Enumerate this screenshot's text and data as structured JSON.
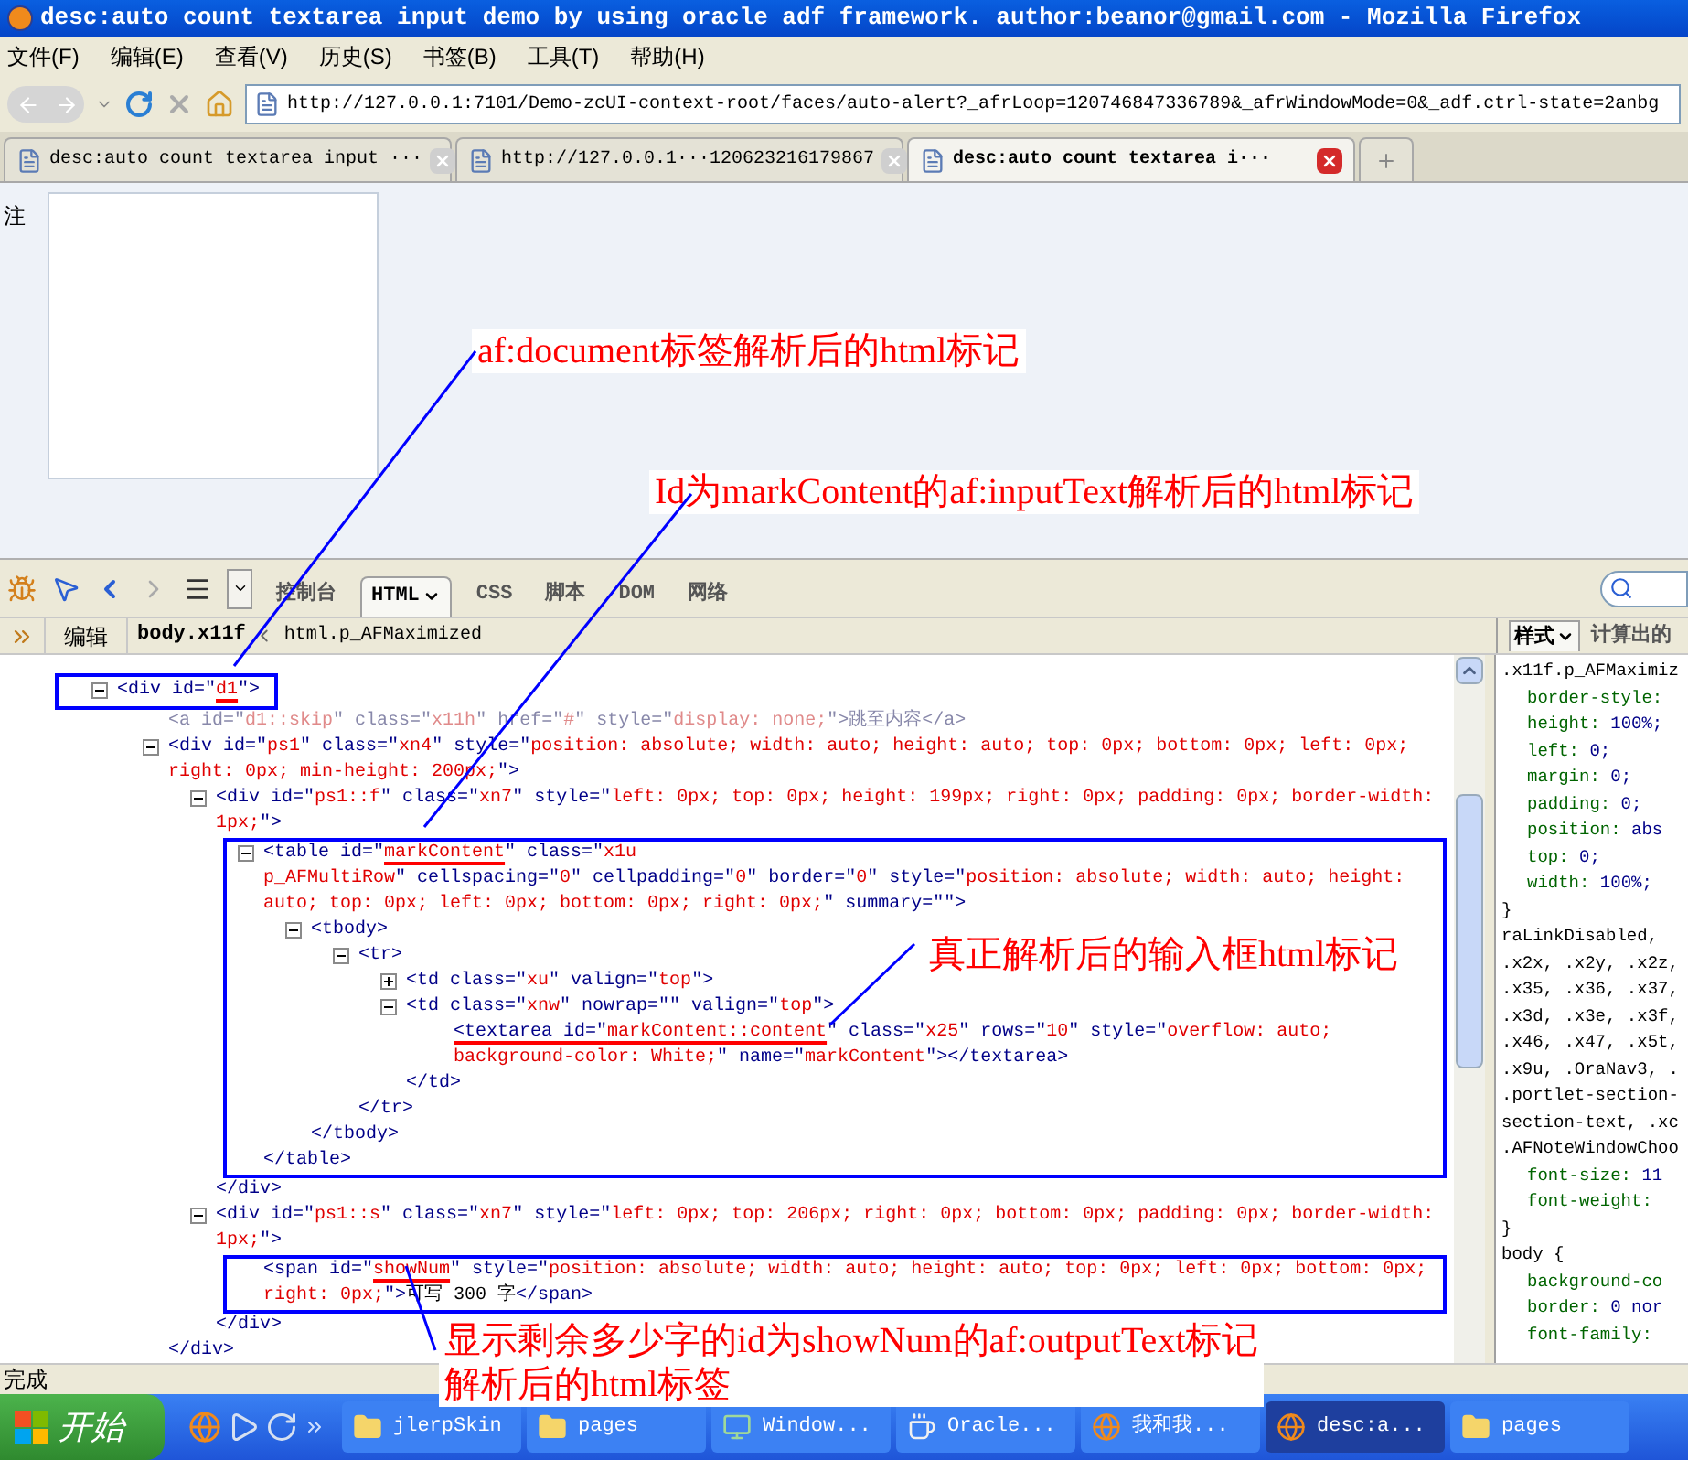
{
  "window": {
    "title": "desc:auto count textarea input demo by using oracle adf framework. author:beanor@gmail.com - Mozilla Firefox"
  },
  "menu": [
    "文件(F)",
    "编辑(E)",
    "查看(V)",
    "历史(S)",
    "书签(B)",
    "工具(T)",
    "帮助(H)"
  ],
  "address": "http://127.0.0.1:7101/Demo-zcUI-context-root/faces/auto-alert?_afrLoop=120746847336789&_afrWindowMode=0&_adf.ctrl-state=2anbg",
  "tabs": [
    {
      "label": "desc:auto count textarea input ···",
      "selected": false
    },
    {
      "label": "http://127.0.0.1···120623216179867",
      "selected": false
    },
    {
      "label": "desc:auto count textarea i···",
      "selected": true
    }
  ],
  "page": {
    "field_label": "注"
  },
  "annotations": [
    {
      "lines": [
        "af:document标签解析后的html标记"
      ]
    },
    {
      "lines": [
        "Id为markContent的af:inputText解析后的html标记"
      ]
    },
    {
      "lines": [
        "真正解析后的输入框html标记"
      ]
    },
    {
      "lines": [
        "显示剩余多少字的id为showNum的af:outputText标记",
        "解析后的html标签"
      ]
    }
  ],
  "firebug": {
    "tabs": [
      {
        "label": "控制台",
        "selected": false,
        "menu": false
      },
      {
        "label": "HTML",
        "selected": true,
        "menu": true
      },
      {
        "label": "CSS",
        "selected": false,
        "menu": false
      },
      {
        "label": "脚本",
        "selected": false,
        "menu": false
      },
      {
        "label": "DOM",
        "selected": false,
        "menu": false
      },
      {
        "label": "网络",
        "selected": false,
        "menu": false
      }
    ],
    "edit_button": "编辑",
    "breadcrumbs": [
      {
        "label": "body.x11f",
        "selected": true
      },
      {
        "label": "html.p_AFMaximized",
        "selected": false
      }
    ],
    "side_tabs": [
      {
        "label": "样式",
        "selected": true,
        "menu": true
      },
      {
        "label": "计算出的",
        "selected": false,
        "menu": false
      }
    ],
    "tree": {
      "expanded": true,
      "kind": "line",
      "open": [
        [
          {
            "kind": "tag",
            "s": "<div id=\""
          },
          {
            "kind": "val",
            "s": "d1",
            "underlined": true
          },
          {
            "kind": "tag",
            "s": "\">"
          }
        ]
      ],
      "children": [
        {
          "open": [
            [
              {
                "kind": "dimtag",
                "s": "<a id=\""
              },
              {
                "kind": "dimval",
                "s": "d1::skip"
              },
              {
                "kind": "dimtag",
                "s": "\" class=\""
              },
              {
                "kind": "dimval",
                "s": "x11h"
              },
              {
                "kind": "dimtag",
                "s": "\" href=\""
              },
              {
                "kind": "dimval",
                "s": "#"
              },
              {
                "kind": "dimtag",
                "s": "\" style=\""
              },
              {
                "kind": "dimval",
                "s": "display: none;"
              },
              {
                "kind": "dimtag",
                "s": "\">跳至内容</a>"
              }
            ]
          ]
        },
        {
          "expanded": true,
          "open": [
            [
              {
                "kind": "tag",
                "s": "<div id=\""
              },
              {
                "kind": "val",
                "s": "ps1"
              },
              {
                "kind": "tag",
                "s": "\" class=\""
              },
              {
                "kind": "val",
                "s": "xn4"
              },
              {
                "kind": "tag",
                "s": "\" style=\""
              },
              {
                "kind": "val",
                "s": "position: absolute; width: auto; height: auto; top: 0px; bottom: 0px; left: 0px;"
              }
            ],
            [
              {
                "kind": "val",
                "s": "right: 0px; min-height: 200px;"
              },
              {
                "kind": "tag",
                "s": "\">"
              }
            ]
          ],
          "children": [
            {
              "expanded": true,
              "open": [
                [
                  {
                    "kind": "tag",
                    "s": "<div id=\""
                  },
                  {
                    "kind": "val",
                    "s": "ps1::f"
                  },
                  {
                    "kind": "tag",
                    "s": "\" class=\""
                  },
                  {
                    "kind": "val",
                    "s": "xn7"
                  },
                  {
                    "kind": "tag",
                    "s": "\" style=\""
                  },
                  {
                    "kind": "val",
                    "s": "left: 0px; top: 0px; height: 199px; right: 0px; padding: 0px; border-width:"
                  }
                ],
                [
                  {
                    "kind": "val",
                    "s": "1px;"
                  },
                  {
                    "kind": "tag",
                    "s": "\">"
                  }
                ]
              ],
              "children": [
                {
                  "expanded": true,
                  "kind": "subtree",
                  "open": [
                    [
                      {
                        "kind": "tag",
                        "s": "<table id=\""
                      },
                      {
                        "kind": "val",
                        "s": "markContent",
                        "underlined": true
                      },
                      {
                        "kind": "tag",
                        "s": "\" class=\""
                      },
                      {
                        "kind": "val",
                        "s": "x1u"
                      }
                    ],
                    [
                      {
                        "kind": "val",
                        "s": "p_AFMultiRow"
                      },
                      {
                        "kind": "tag",
                        "s": "\" cellspacing=\""
                      },
                      {
                        "kind": "val",
                        "s": "0"
                      },
                      {
                        "kind": "tag",
                        "s": "\" cellpadding=\""
                      },
                      {
                        "kind": "val",
                        "s": "0"
                      },
                      {
                        "kind": "tag",
                        "s": "\" border=\""
                      },
                      {
                        "kind": "val",
                        "s": "0"
                      },
                      {
                        "kind": "tag",
                        "s": "\" style=\""
                      },
                      {
                        "kind": "val",
                        "s": "position: absolute; width: auto; height:"
                      }
                    ],
                    [
                      {
                        "kind": "val",
                        "s": "auto; top: 0px; left: 0px; bottom: 0px; right: 0px;"
                      },
                      {
                        "kind": "tag",
                        "s": "\" summary=\"\">"
                      }
                    ]
                  ],
                  "children": [
                    {
                      "expanded": true,
                      "open": [
                        [
                          {
                            "kind": "tag",
                            "s": "<tbody>"
                          }
                        ]
                      ],
                      "children": [
                        {
                          "expanded": true,
                          "open": [
                            [
                              {
                                "kind": "tag",
                                "s": "<tr>"
                              }
                            ]
                          ],
                          "children": [
                            {
                              "expanded": false,
                              "open": [
                                [
                                  {
                                    "kind": "tag",
                                    "s": "<td class=\""
                                  },
                                  {
                                    "kind": "val",
                                    "s": "xu"
                                  },
                                  {
                                    "kind": "tag",
                                    "s": "\" valign=\""
                                  },
                                  {
                                    "kind": "val",
                                    "s": "top"
                                  },
                                  {
                                    "kind": "tag",
                                    "s": "\">"
                                  }
                                ]
                              ]
                            },
                            {
                              "expanded": true,
                              "open": [
                                [
                                  {
                                    "kind": "tag",
                                    "s": "<td class=\""
                                  },
                                  {
                                    "kind": "val",
                                    "s": "xnw"
                                  },
                                  {
                                    "kind": "tag",
                                    "s": "\" nowrap=\"\" valign=\""
                                  },
                                  {
                                    "kind": "val",
                                    "s": "top"
                                  },
                                  {
                                    "kind": "tag",
                                    "s": "\">"
                                  }
                                ]
                              ],
                              "children": [
                                {
                                  "open": [
                                    [
                                      {
                                        "kind": "tag",
                                        "s": "<textarea id=\"",
                                        "underlined": true
                                      },
                                      {
                                        "kind": "val",
                                        "s": "markContent::content",
                                        "underlined": true
                                      },
                                      {
                                        "kind": "tag",
                                        "s": "\" class=\""
                                      },
                                      {
                                        "kind": "val",
                                        "s": "x25"
                                      },
                                      {
                                        "kind": "tag",
                                        "s": "\" rows=\""
                                      },
                                      {
                                        "kind": "val",
                                        "s": "10"
                                      },
                                      {
                                        "kind": "tag",
                                        "s": "\" style=\""
                                      },
                                      {
                                        "kind": "val",
                                        "s": "overflow: auto;"
                                      }
                                    ],
                                    [
                                      {
                                        "kind": "val",
                                        "s": "background-color: White;"
                                      },
                                      {
                                        "kind": "tag",
                                        "s": "\" name=\""
                                      },
                                      {
                                        "kind": "val",
                                        "s": "markContent"
                                      },
                                      {
                                        "kind": "tag",
                                        "s": "\"></textarea>"
                                      }
                                    ]
                                  ]
                                }
                              ],
                              "close": [
                                {
                                  "kind": "tag",
                                  "s": "</td>"
                                }
                              ]
                            }
                          ],
                          "close": [
                            {
                              "kind": "tag",
                              "s": "</tr>"
                            }
                          ]
                        }
                      ],
                      "close": [
                        {
                          "kind": "tag",
                          "s": "</tbody>"
                        }
                      ]
                    }
                  ],
                  "close": [
                    {
                      "kind": "tag",
                      "s": "</table>"
                    }
                  ]
                }
              ],
              "close": [
                {
                  "kind": "tag",
                  "s": "</div>"
                }
              ]
            },
            {
              "expanded": true,
              "open": [
                [
                  {
                    "kind": "tag",
                    "s": "<div id=\""
                  },
                  {
                    "kind": "val",
                    "s": "ps1::s"
                  },
                  {
                    "kind": "tag",
                    "s": "\" class=\""
                  },
                  {
                    "kind": "val",
                    "s": "xn7"
                  },
                  {
                    "kind": "tag",
                    "s": "\" style=\""
                  },
                  {
                    "kind": "val",
                    "s": "left: 0px; top: 206px; right: 0px; bottom: 0px; padding: 0px; border-width:"
                  }
                ],
                [
                  {
                    "kind": "val",
                    "s": "1px;"
                  },
                  {
                    "kind": "tag",
                    "s": "\">"
                  }
                ]
              ],
              "children": [
                {
                  "kind": "lines",
                  "open": [
                    [
                      {
                        "kind": "tag",
                        "s": "<span id=\""
                      },
                      {
                        "kind": "val",
                        "s": "showNum",
                        "underlined": true
                      },
                      {
                        "kind": "tag",
                        "s": "\" style=\""
                      },
                      {
                        "kind": "val",
                        "s": "position: absolute; width: auto; height: auto; top: 0px; left: 0px; bottom: 0px;"
                      }
                    ],
                    [
                      {
                        "kind": "val",
                        "s": "right: 0px;"
                      },
                      {
                        "kind": "tag",
                        "s": "\">"
                      },
                      {
                        "kind": "txt",
                        "s": "可写 300 字"
                      },
                      {
                        "kind": "tag",
                        "s": "</span>"
                      }
                    ]
                  ]
                }
              ],
              "close": [
                {
                  "kind": "tag",
                  "s": "</div>"
                }
              ]
            }
          ],
          "close": [
            {
              "kind": "tag",
              "s": "</div>"
            }
          ]
        }
      ]
    },
    "styles": [
      {
        "kind": "sel",
        "s": ".x11f.p_AFMaximiz"
      },
      {
        "kind": "prop",
        "name": "border-style:"
      },
      {
        "kind": "prop",
        "name": "height:",
        "value": "100%;"
      },
      {
        "kind": "prop",
        "name": "left:",
        "value": "0;"
      },
      {
        "kind": "prop",
        "name": "margin:",
        "value": "0;"
      },
      {
        "kind": "prop",
        "name": "padding:",
        "value": "0;"
      },
      {
        "kind": "prop",
        "name": "position:",
        "value": "abs"
      },
      {
        "kind": "prop",
        "name": "top:",
        "value": "0;"
      },
      {
        "kind": "prop",
        "name": "width:",
        "value": "100%;"
      },
      {
        "kind": "sel",
        "s": "}"
      },
      {
        "kind": "sel",
        "s": "raLinkDisabled,"
      },
      {
        "kind": "sel",
        "s": ".x2x, .x2y, .x2z,"
      },
      {
        "kind": "sel",
        "s": ".x35, .x36, .x37,"
      },
      {
        "kind": "sel",
        "s": ".x3d, .x3e, .x3f,"
      },
      {
        "kind": "sel",
        "s": ".x46, .x47, .x5t,"
      },
      {
        "kind": "sel",
        "s": ".x9u, .OraNav3, ."
      },
      {
        "kind": "sel",
        "s": ".portlet-section-"
      },
      {
        "kind": "sel",
        "s": "section-text, .xc"
      },
      {
        "kind": "sel",
        "s": ".AFNoteWindowChoo"
      },
      {
        "kind": "prop",
        "name": "font-size:",
        "value": "11"
      },
      {
        "kind": "prop",
        "name": "font-weight:"
      },
      {
        "kind": "sel",
        "s": "}"
      },
      {
        "kind": "sel",
        "s": "body {"
      },
      {
        "kind": "prop",
        "name": "background-co"
      },
      {
        "kind": "prop",
        "name": "border:",
        "value": "0 nor"
      },
      {
        "kind": "prop",
        "name": "font-family:"
      }
    ]
  },
  "status_bar": "完成",
  "taskbar": {
    "start": "开始",
    "items": [
      {
        "label": "jlerpSkin",
        "kind": "folder",
        "selected": false
      },
      {
        "label": "pages",
        "kind": "folder",
        "selected": false
      },
      {
        "label": "Window...",
        "kind": "app",
        "selected": false
      },
      {
        "label": "Oracle...",
        "kind": "cup",
        "selected": false
      },
      {
        "label": "我和我...",
        "kind": "browser",
        "selected": false
      },
      {
        "label": "desc:a...",
        "kind": "browser",
        "selected": true
      },
      {
        "label": "pages",
        "kind": "folder",
        "selected": false
      }
    ]
  }
}
